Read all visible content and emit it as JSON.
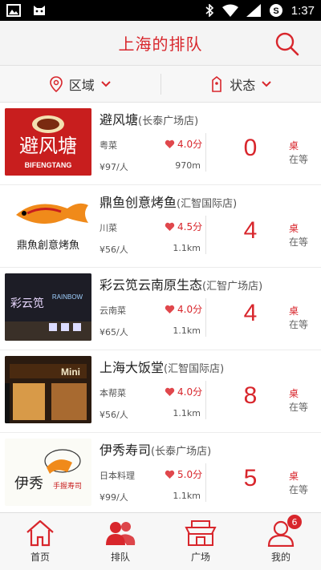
{
  "status_bar": {
    "time": "1:37"
  },
  "header": {
    "title": "上海的排队"
  },
  "filters": [
    {
      "label": "区域"
    },
    {
      "label": "状态"
    }
  ],
  "restaurants": [
    {
      "name": "避风塘",
      "branch": "(长泰广场店)",
      "cuisine": "粤菜",
      "rating": "4.0分",
      "price": "¥97/人",
      "distance": "970m",
      "queue": "0",
      "unit": "桌",
      "status": "在等",
      "logo_text": "避风塘",
      "logo_sub": "BIFENGTANG"
    },
    {
      "name": "鼎鱼创意烤鱼",
      "branch": "(汇智国际店)",
      "cuisine": "川菜",
      "rating": "4.5分",
      "price": "¥56/人",
      "distance": "1.1km",
      "queue": "4",
      "unit": "桌",
      "status": "在等",
      "logo_text": "鼎魚創意烤魚"
    },
    {
      "name": "彩云笕云南原生态",
      "branch": "(汇智广场店)",
      "cuisine": "云南菜",
      "rating": "4.0分",
      "price": "¥65/人",
      "distance": "1.1km",
      "queue": "4",
      "unit": "桌",
      "status": "在等",
      "logo_text": "彩云笕",
      "logo_sub": "RAINBOW"
    },
    {
      "name": "上海大饭堂",
      "branch": "(汇智国际店)",
      "cuisine": "本帮菜",
      "rating": "4.0分",
      "price": "¥56/人",
      "distance": "1.1km",
      "queue": "8",
      "unit": "桌",
      "status": "在等",
      "logo_text": "Mini"
    },
    {
      "name": "伊秀寿司",
      "branch": "(长泰广场店)",
      "cuisine": "日本料理",
      "rating": "5.0分",
      "price": "¥99/人",
      "distance": "1.1km",
      "queue": "5",
      "unit": "桌",
      "status": "在等",
      "logo_text": "伊秀",
      "logo_sub": "手握寿司"
    }
  ],
  "bottom_nav": [
    {
      "label": "首页"
    },
    {
      "label": "排队"
    },
    {
      "label": "广场"
    },
    {
      "label": "我的",
      "badge": "6"
    }
  ],
  "colors": {
    "accent": "#d8262c"
  }
}
